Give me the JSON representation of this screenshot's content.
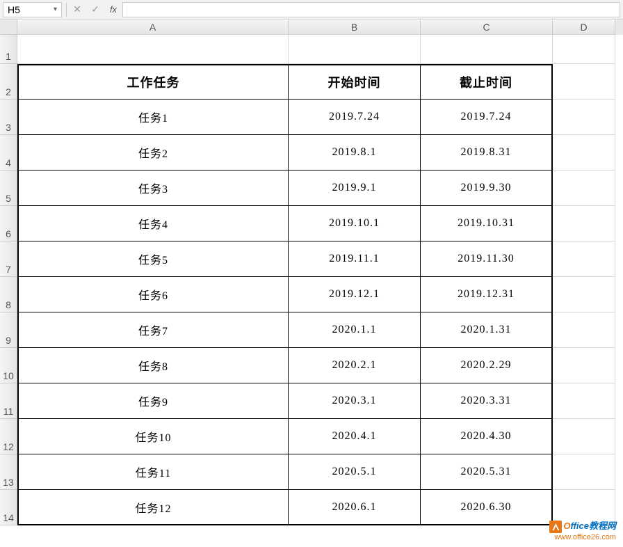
{
  "nameBox": "H5",
  "formulaBar": {
    "cancel": "✕",
    "confirm": "✓",
    "fx": "fx"
  },
  "columns": [
    "A",
    "B",
    "C",
    "D"
  ],
  "rowNumbers": [
    "1",
    "2",
    "3",
    "4",
    "5",
    "6",
    "7",
    "8",
    "9",
    "10",
    "11",
    "12",
    "13",
    "14"
  ],
  "headers": {
    "task": "工作任务",
    "start": "开始时间",
    "end": "截止时间"
  },
  "rows": [
    {
      "task": "任务1",
      "start": "2019.7.24",
      "end": "2019.7.24"
    },
    {
      "task": "任务2",
      "start": "2019.8.1",
      "end": "2019.8.31"
    },
    {
      "task": "任务3",
      "start": "2019.9.1",
      "end": "2019.9.30"
    },
    {
      "task": "任务4",
      "start": "2019.10.1",
      "end": "2019.10.31"
    },
    {
      "task": "任务5",
      "start": "2019.11.1",
      "end": "2019.11.30"
    },
    {
      "task": "任务6",
      "start": "2019.12.1",
      "end": "2019.12.31"
    },
    {
      "task": "任务7",
      "start": "2020.1.1",
      "end": "2020.1.31"
    },
    {
      "task": "任务8",
      "start": "2020.2.1",
      "end": "2020.2.29"
    },
    {
      "task": "任务9",
      "start": "2020.3.1",
      "end": "2020.3.31"
    },
    {
      "task": "任务10",
      "start": "2020.4.1",
      "end": "2020.4.30"
    },
    {
      "task": "任务11",
      "start": "2020.5.1",
      "end": "2020.5.31"
    },
    {
      "task": "任务12",
      "start": "2020.6.1",
      "end": "2020.6.30"
    }
  ],
  "watermark": {
    "brandO": "O",
    "brandRest": "ffice教程网",
    "url": "www.office26.com"
  }
}
